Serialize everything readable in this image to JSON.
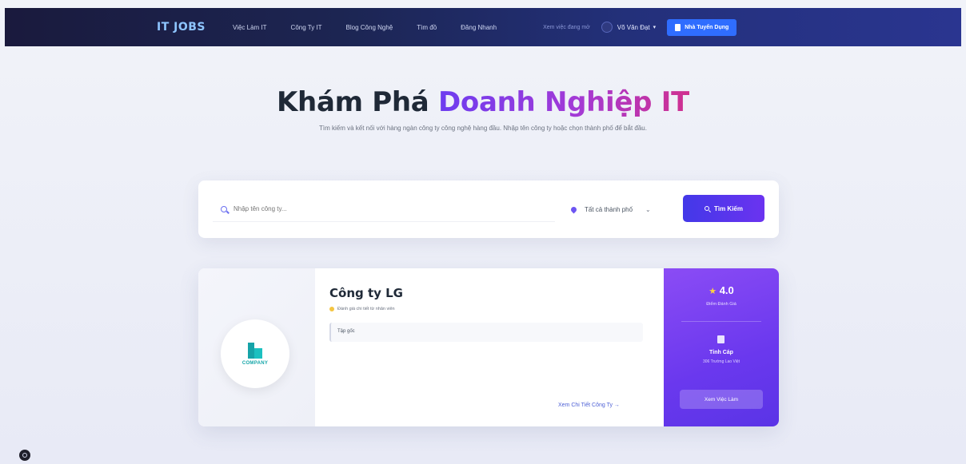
{
  "navbar": {
    "logo": "IT JOBS",
    "links": [
      "Việc Làm IT",
      "Công Ty IT",
      "Blog Công Nghệ",
      "Tìm đồ",
      "Đăng Nhanh"
    ],
    "muted_text": "Xem việc đang mở",
    "user_name": "Võ Văn Đạt",
    "employer_button": "Nhà Tuyển Dụng"
  },
  "hero": {
    "title_plain": "Khám Phá",
    "title_highlight": "Doanh Nghiệp IT",
    "subtitle": "Tìm kiếm và kết nối với hàng ngàn công ty công nghệ hàng đầu. Nhập tên công ty hoặc chọn thành phố để bắt đầu."
  },
  "search": {
    "placeholder": "Nhập tên công ty...",
    "city": "Tất cả thành phố",
    "button": "Tìm Kiếm"
  },
  "company": {
    "name": "Công ty LG",
    "review_note": "Đánh giá chi tiết từ nhân viên",
    "description": "Tập gốc",
    "logo_text": "COMPANY",
    "detail_link": "Xem Chi Tiết Công Ty →",
    "rating": "4.0",
    "rating_label": "Điểm Đánh Giá",
    "city": "Tỉnh Cáp",
    "jobs_text": "306 Trường Lao Việt",
    "jobs_button": "Xem Việc Làm"
  },
  "colors": {
    "accent": "#6b33f0",
    "card_gradient_start": "#8b4cf5",
    "navbar_bg": "#1c2552",
    "logo": "#8ec5ff"
  }
}
